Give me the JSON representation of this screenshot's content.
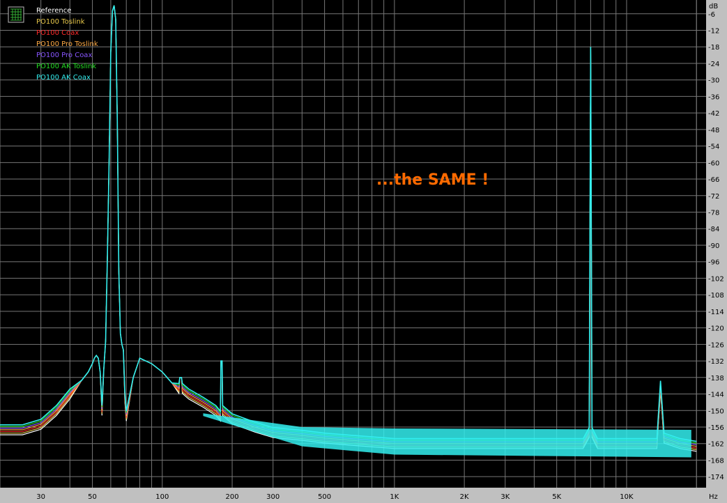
{
  "chart_data": {
    "type": "line",
    "title": "",
    "xlabel": "Hz",
    "ylabel": "dB",
    "x_scale": "log",
    "xlim": [
      20,
      22000
    ],
    "ylim": [
      -178,
      -1
    ],
    "grid": true,
    "legend_placement": "top-left",
    "background": "#000000",
    "x_ticks": [
      {
        "v": 30,
        "label": "30"
      },
      {
        "v": 50,
        "label": "50"
      },
      {
        "v": 100,
        "label": "100"
      },
      {
        "v": 200,
        "label": "200"
      },
      {
        "v": 300,
        "label": "300"
      },
      {
        "v": 500,
        "label": "500"
      },
      {
        "v": 1000,
        "label": "1K"
      },
      {
        "v": 2000,
        "label": "2K"
      },
      {
        "v": 3000,
        "label": "3K"
      },
      {
        "v": 5000,
        "label": "5K"
      },
      {
        "v": 10000,
        "label": "10K"
      }
    ],
    "y_ticks": [
      -6,
      -12,
      -18,
      -24,
      -30,
      -36,
      -42,
      -48,
      -54,
      -60,
      -66,
      -72,
      -78,
      -84,
      -90,
      -96,
      -102,
      -108,
      -114,
      -120,
      -126,
      -132,
      -138,
      -144,
      -150,
      -156,
      -162,
      -168,
      -174
    ],
    "annotation": {
      "text": "...the SAME !",
      "color": "#ff6a00"
    },
    "series": [
      {
        "name": "Reference",
        "color": "#ffffff"
      },
      {
        "name": "PO100 Toslink",
        "color": "#e8c84a"
      },
      {
        "name": "PO100 Coax",
        "color": "#ff2a2a"
      },
      {
        "name": "PO100 Pro Toslink",
        "color": "#ffaa44"
      },
      {
        "name": "PO100 Pro Coax",
        "color": "#8855ff"
      },
      {
        "name": "PO100 AK Toslink",
        "color": "#22dd22"
      },
      {
        "name": "PO100 AK Coax",
        "color": "#33eeee"
      }
    ],
    "shared_curve": {
      "x": [
        20,
        25,
        30,
        35,
        40,
        45,
        48,
        50,
        51,
        52,
        53,
        54,
        55,
        56,
        57,
        58,
        59,
        60,
        61,
        62,
        63,
        64,
        65,
        66,
        67,
        68,
        69,
        70,
        75,
        80,
        90,
        100,
        110,
        118,
        119,
        120,
        121,
        122,
        130,
        150,
        170,
        178,
        179,
        180,
        181,
        182,
        200,
        250,
        300,
        400,
        500,
        700,
        1000,
        2000,
        3000,
        5000,
        6500,
        6900,
        7000,
        7100,
        7500,
        10000,
        13500,
        14000,
        14500,
        17000,
        20000
      ],
      "y": [
        -157,
        -157,
        -155,
        -150,
        -144,
        -139,
        -136,
        -133,
        -131,
        -130,
        -131,
        -136,
        -150,
        -135,
        -125,
        -95,
        -60,
        -20,
        -5,
        -3,
        -8,
        -45,
        -100,
        -122,
        -126,
        -128,
        -145,
        -152,
        -138,
        -131,
        -133,
        -136,
        -140,
        -142,
        -138,
        -138,
        -138,
        -142,
        -144,
        -147,
        -150,
        -152,
        -132,
        -132,
        -132,
        -150,
        -153,
        -156,
        -158,
        -159,
        -160,
        -161,
        -162,
        -162,
        -162,
        -162,
        -162,
        -158,
        -18,
        -158,
        -162,
        -162,
        -162,
        -141,
        -160,
        -162,
        -163
      ]
    }
  }
}
